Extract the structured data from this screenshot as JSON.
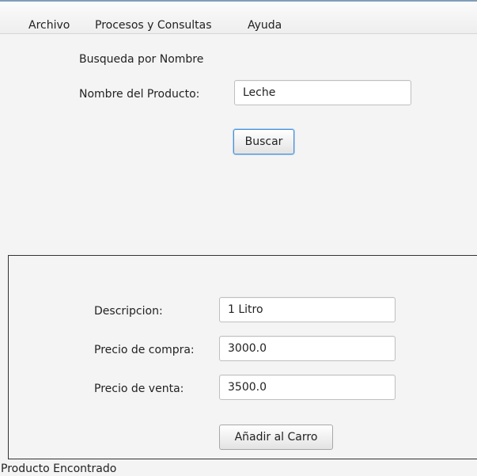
{
  "menubar": {
    "items": [
      {
        "label": "Archivo"
      },
      {
        "label": "Procesos y Consultas"
      },
      {
        "label": "Ayuda"
      }
    ]
  },
  "search": {
    "section_title": "Busqueda por Nombre",
    "product_name_label": "Nombre del Producto:",
    "product_name_value": "Leche",
    "search_button": "Buscar"
  },
  "result": {
    "description_label": "Descripcion:",
    "description_value": "1 Litro",
    "purchase_price_label": "Precio de compra:",
    "purchase_price_value": "3000.0",
    "sale_price_label": "Precio de venta:",
    "sale_price_value": "3500.0",
    "add_to_cart_button": "Añadir al Carro"
  },
  "status": {
    "text": "Producto Encontrado"
  }
}
